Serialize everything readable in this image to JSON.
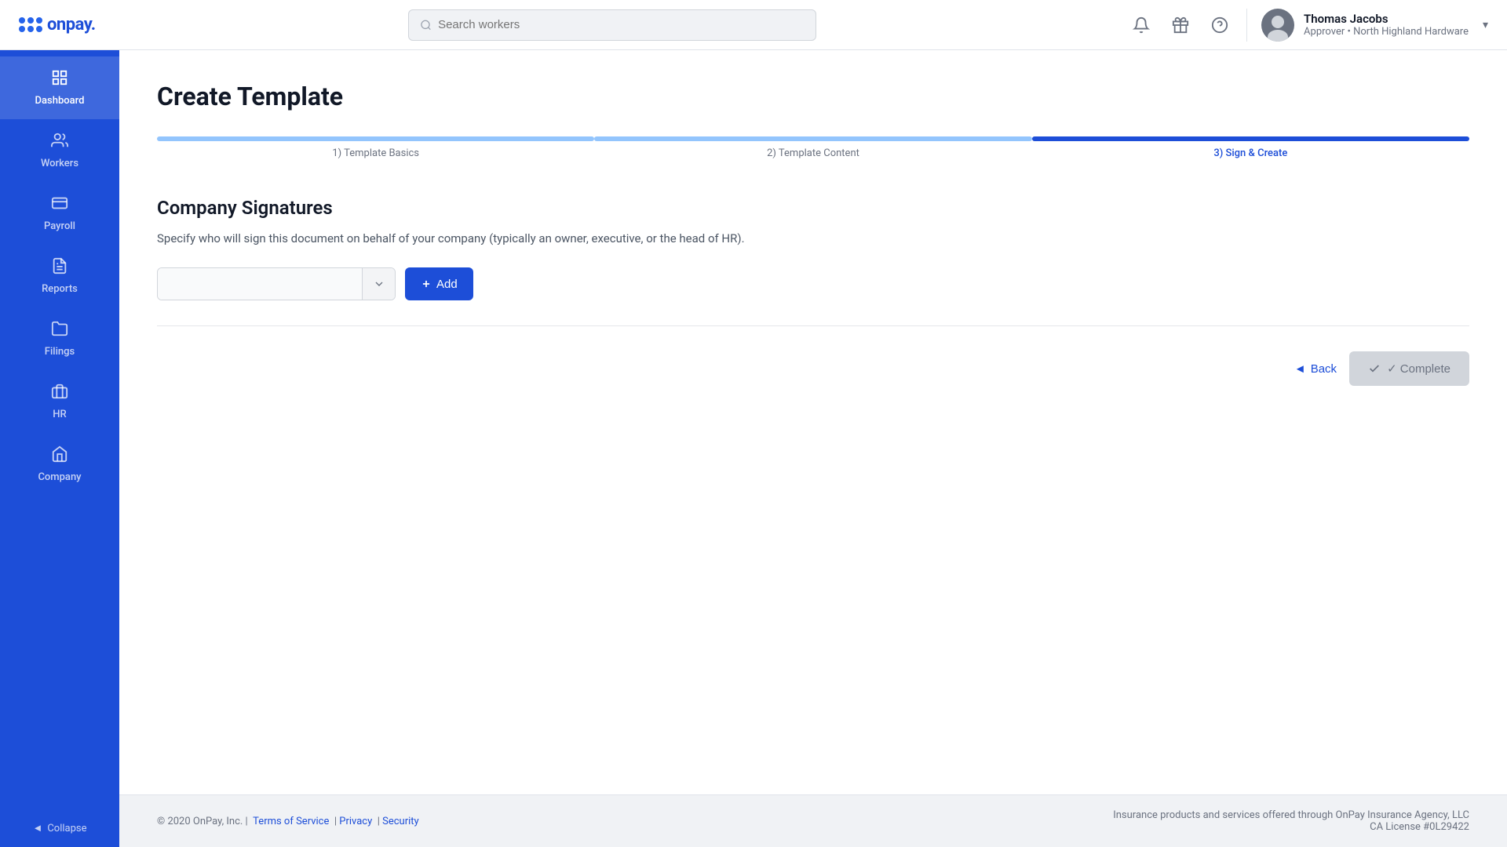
{
  "header": {
    "logo_text": "onpay.",
    "search_placeholder": "Search workers",
    "user": {
      "name": "Thomas Jacobs",
      "role": "Approver • North Highland Hardware"
    }
  },
  "sidebar": {
    "items": [
      {
        "id": "dashboard",
        "label": "Dashboard",
        "icon": "⊞"
      },
      {
        "id": "workers",
        "label": "Workers",
        "icon": "👤"
      },
      {
        "id": "payroll",
        "label": "Payroll",
        "icon": "💳"
      },
      {
        "id": "reports",
        "label": "Reports",
        "icon": "📊"
      },
      {
        "id": "filings",
        "label": "Filings",
        "icon": "🗂"
      },
      {
        "id": "hr",
        "label": "HR",
        "icon": "🏢"
      },
      {
        "id": "company",
        "label": "Company",
        "icon": "🏬"
      }
    ],
    "collapse_label": "Collapse"
  },
  "page": {
    "title": "Create Template",
    "steps": [
      {
        "id": "template-basics",
        "label": "1) Template Basics",
        "state": "completed"
      },
      {
        "id": "template-content",
        "label": "2) Template Content",
        "state": "completed"
      },
      {
        "id": "sign-create",
        "label": "3) Sign & Create",
        "state": "active"
      }
    ],
    "section_title": "Company Signatures",
    "section_desc": "Specify who will sign this document on behalf of your company (typically an owner, executive, or the head of HR).",
    "select_placeholder": "",
    "add_label": "+ Add",
    "back_label": "◄ Back",
    "complete_label": "✓ Complete"
  },
  "footer": {
    "copyright": "© 2020 OnPay, Inc. |",
    "terms_label": "Terms of Service",
    "privacy_label": "Privacy",
    "security_label": "Security",
    "insurance_text": "Insurance products and services offered through OnPay Insurance Agency, LLC",
    "license_text": "CA License #0L29422"
  }
}
